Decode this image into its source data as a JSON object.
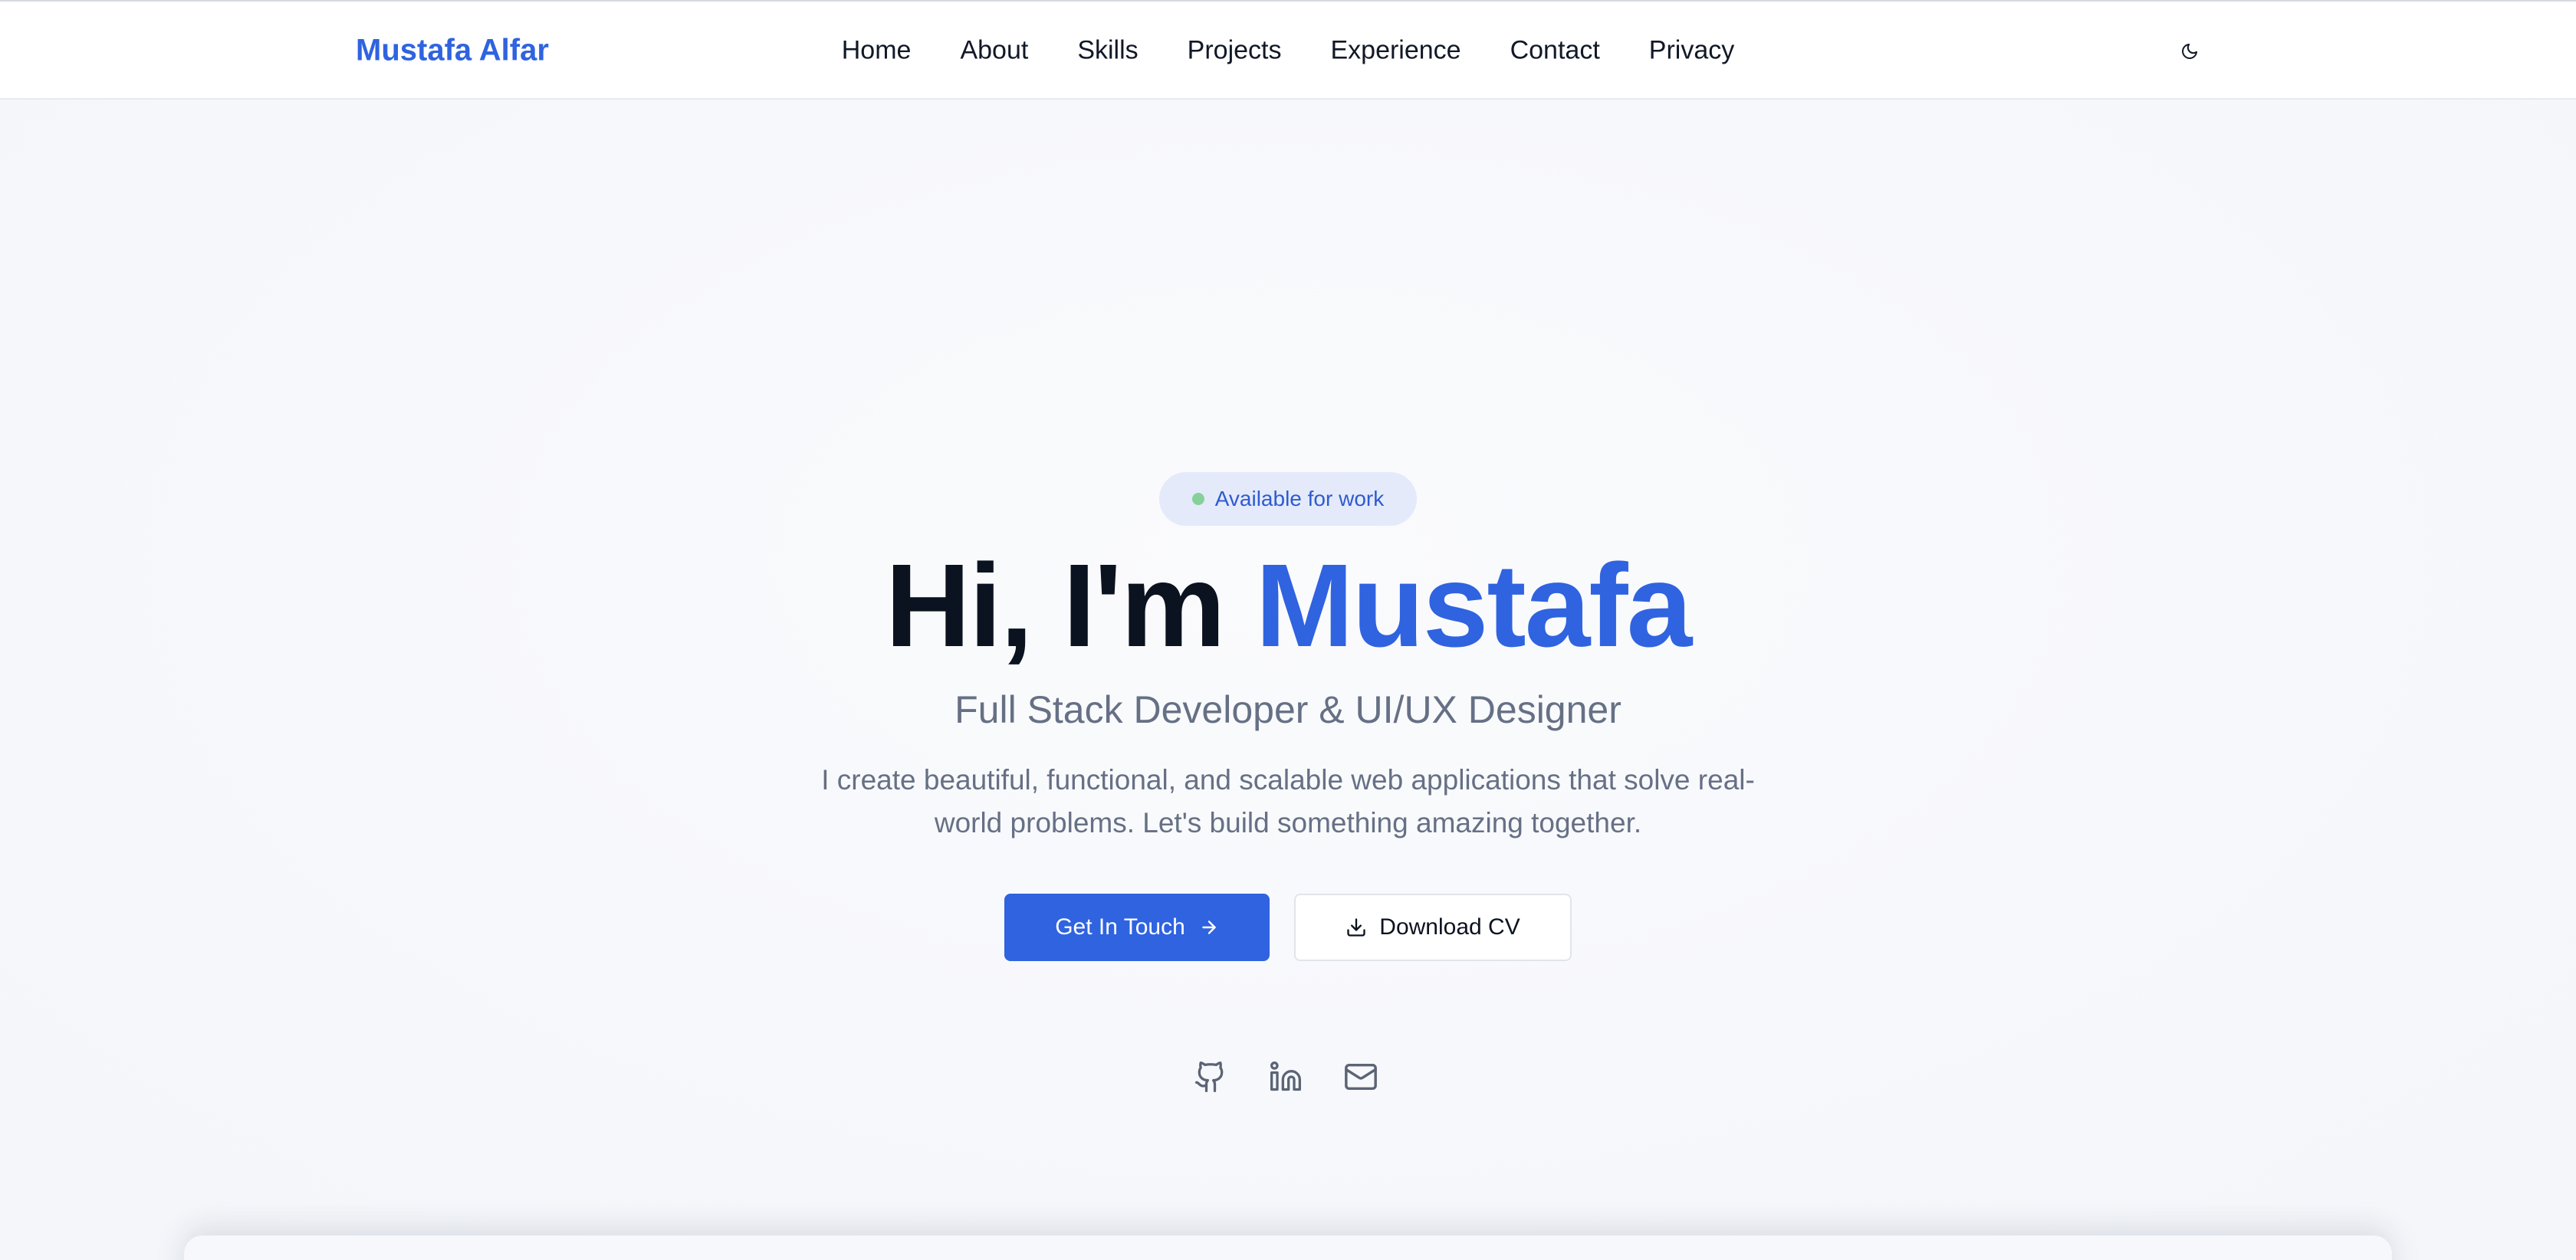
{
  "header": {
    "brand": "Mustafa Alfar",
    "nav": [
      {
        "label": "Home"
      },
      {
        "label": "About"
      },
      {
        "label": "Skills"
      },
      {
        "label": "Projects"
      },
      {
        "label": "Experience"
      },
      {
        "label": "Contact"
      },
      {
        "label": "Privacy"
      }
    ],
    "theme_toggle_icon": "moon-icon"
  },
  "hero": {
    "badge": "Available for work",
    "headline_prefix": "Hi, I'm ",
    "headline_name": "Mustafa",
    "subtitle": "Full Stack Developer & UI/UX Designer",
    "description": "I create beautiful, functional, and scalable web applications that solve real-world problems. Let's build something amazing together.",
    "primary_cta": "Get In Touch",
    "secondary_cta": "Download CV",
    "socials": [
      {
        "icon": "github-icon"
      },
      {
        "icon": "linkedin-icon"
      },
      {
        "icon": "mail-icon"
      }
    ]
  },
  "colors": {
    "accent": "#2f63e0",
    "badge_bg": "#e4eafa",
    "badge_dot": "#86d19a",
    "muted_text": "#667085",
    "heading_text": "#0b1220"
  }
}
